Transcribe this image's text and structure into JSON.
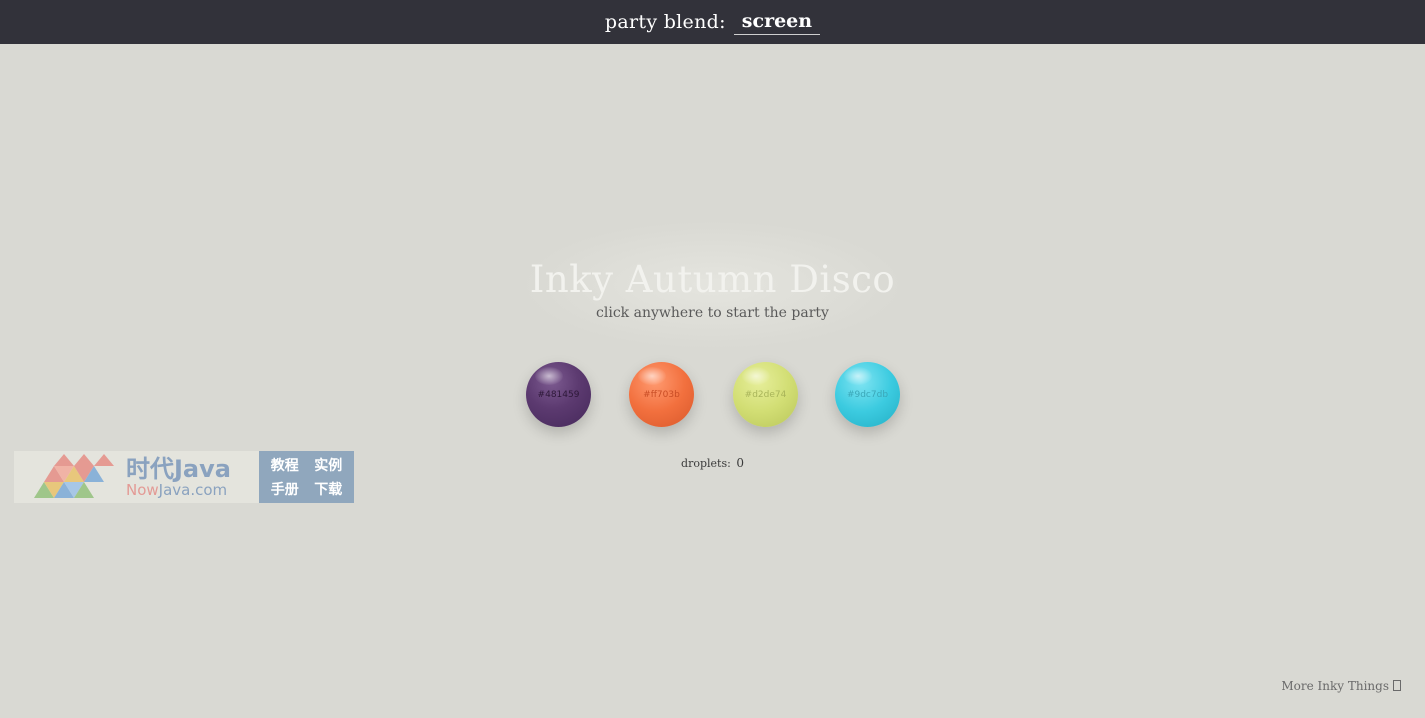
{
  "header": {
    "label": "party blend:",
    "blend_value": "screen"
  },
  "main": {
    "title": "Inky Autumn Disco",
    "subtitle": "click anywhere to start the party",
    "orbs": [
      {
        "label": "#481459",
        "color": "#5c3a70"
      },
      {
        "label": "#ff703b",
        "color": "#f2703e"
      },
      {
        "label": "#d2de74",
        "color": "#d2de74"
      },
      {
        "label": "#9dc7db",
        "color": "#3ccbe0"
      }
    ],
    "droplets_label": "droplets:",
    "droplets_count": "0"
  },
  "watermark": {
    "title": "时代Java",
    "site_now": "Now",
    "site_rest": "Java.com",
    "tags": [
      "教程",
      "实例",
      "手册",
      "下载"
    ]
  },
  "footer": {
    "more_link": "More Inky Things"
  }
}
